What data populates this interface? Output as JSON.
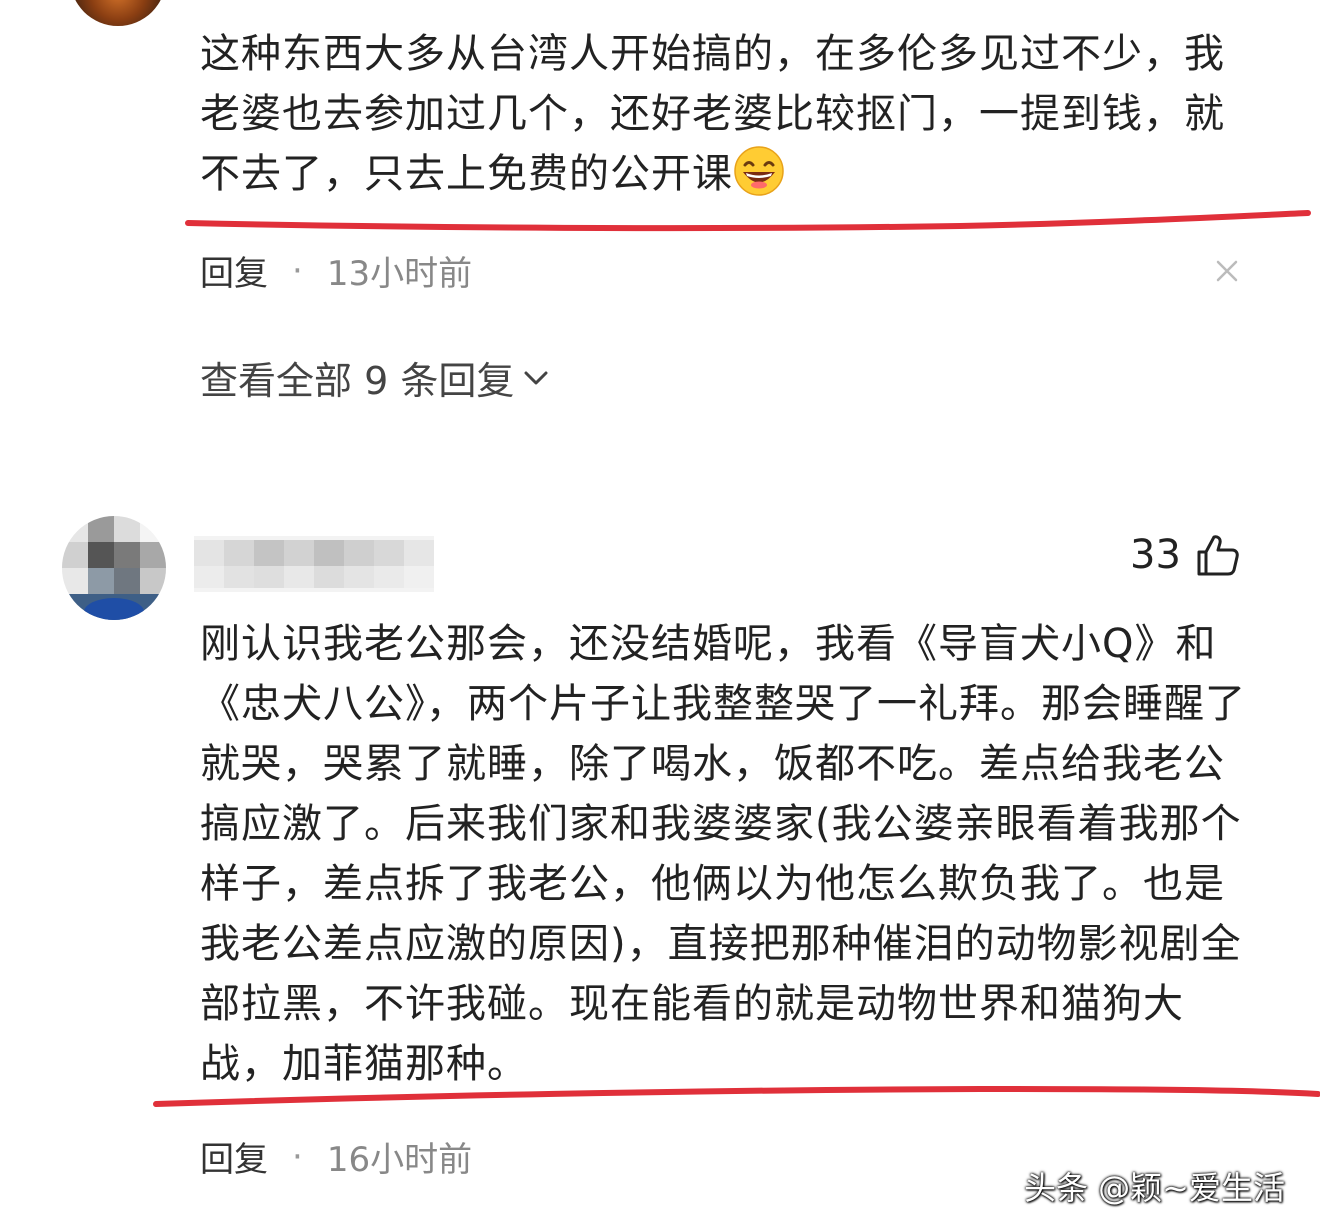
{
  "comments": [
    {
      "text": "这种东西大多从台湾人开始搞的，在多伦多见过不少，我老婆也去参加过几个，还好老婆比较抠门，一提到钱，就不去了，只去上免费的公开课",
      "emoji": "laughing-emoji",
      "reply_label": "回复",
      "separator": "·",
      "time": "13小时前"
    },
    {
      "text": "刚认识我老公那会，还没结婚呢，我看《导盲犬小Q》和《忠犬八公》，两个片子让我整整哭了一礼拜。那会睡醒了就哭，哭累了就睡，除了喝水，饭都不吃。差点给我老公搞应激了。后来我们家和我婆婆家(我公婆亲眼看着我那个样子，差点拆了我老公，他俩以为他怎么欺负我了。也是我老公差点应激的原因)，直接把那种催泪的动物影视剧全部拉黑，不许我碰。现在能看的就是动物世界和猫狗大战，加菲猫那种。",
      "likes": "33",
      "reply_label": "回复",
      "separator": "·",
      "time": "16小时前"
    }
  ],
  "view_all_replies": "查看全部 9 条回复",
  "watermark": "头条 @颖~爱生活",
  "colors": {
    "underline": "#e0303a",
    "text": "#222222",
    "meta": "#888888"
  },
  "icons": [
    "close-icon",
    "chevron-down-icon",
    "thumbs-up-icon",
    "laughing-emoji"
  ]
}
